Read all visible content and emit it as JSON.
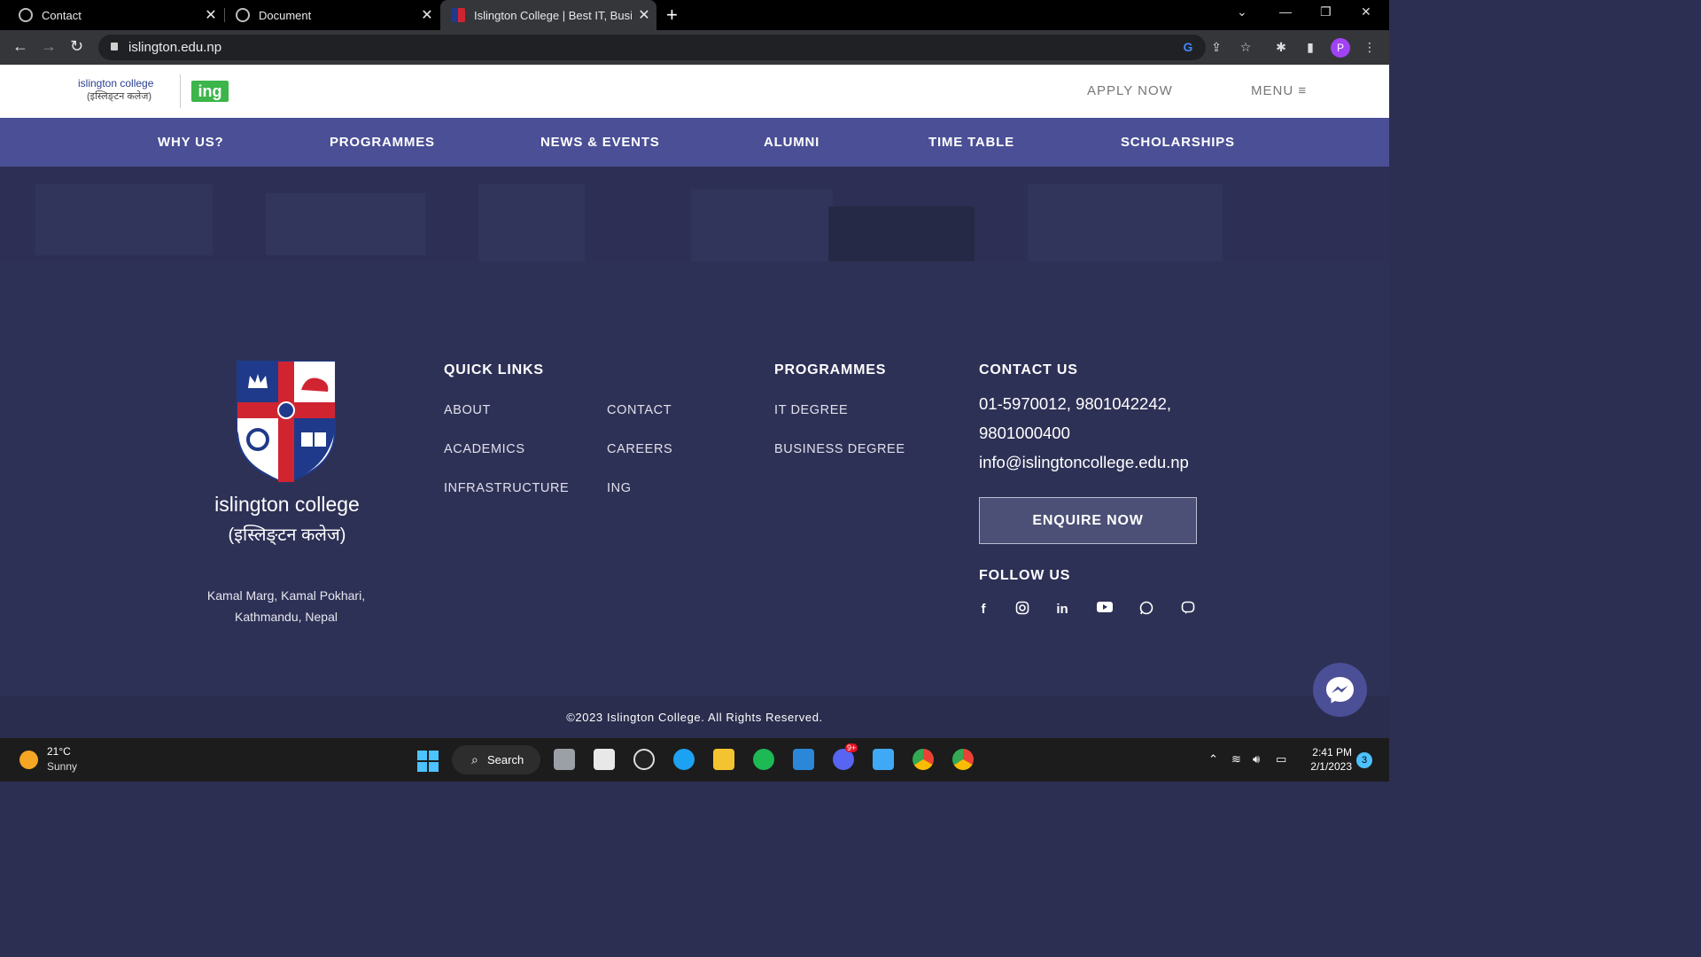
{
  "browser": {
    "tabs": [
      {
        "title": "Contact"
      },
      {
        "title": "Document"
      },
      {
        "title": "Islington College | Best IT, Busine"
      }
    ],
    "url": "islington.edu.np",
    "profile_initial": "P"
  },
  "header": {
    "logo_brand": "islington college",
    "logo_devanagari": "(इस्लिङ्टन कलेज)",
    "partner_logo": "ing",
    "apply_label": "APPLY NOW",
    "menu_label": "MENU ≡"
  },
  "nav": {
    "items": [
      "WHY US?",
      "PROGRAMMES",
      "NEWS & EVENTS",
      "ALUMNI",
      "TIME TABLE",
      "SCHOLARSHIPS"
    ]
  },
  "footer": {
    "college_name": "islington college",
    "college_devanagari": "(इस्लिङ्टन कलेज)",
    "address_line1": "Kamal Marg, Kamal Pokhari,",
    "address_line2": "Kathmandu, Nepal",
    "quick_links": {
      "heading": "QUICK LINKS",
      "col1": [
        "ABOUT",
        "ACADEMICS",
        "INFRASTRUCTURE"
      ],
      "col2": [
        "CONTACT",
        "CAREERS",
        "ING"
      ]
    },
    "programmes": {
      "heading": "PROGRAMMES",
      "items": [
        "IT DEGREE",
        "BUSINESS DEGREE"
      ]
    },
    "contact": {
      "heading": "CONTACT US",
      "phone_line1": "01-5970012, 9801042242,",
      "phone_line2": "9801000400",
      "email": "info@islingtoncollege.edu.np",
      "enquire_label": "ENQUIRE NOW"
    },
    "follow": {
      "heading": "FOLLOW US",
      "icons": [
        "facebook-icon",
        "instagram-icon",
        "linkedin-icon",
        "youtube-icon",
        "whatsapp-icon",
        "viber-icon"
      ]
    },
    "copyright": "©2023 Islington College. All Rights Reserved."
  },
  "taskbar": {
    "temperature": "21°C",
    "weather": "Sunny",
    "search_label": "Search",
    "time": "2:41 PM",
    "date": "2/1/2023",
    "notification_count": "3",
    "discord_badge": "9+"
  },
  "colors": {
    "nav_bg": "#4a4f96",
    "footer_bg": "#2e3156",
    "ing_green": "#3cb54a",
    "crest_red": "#d12431",
    "crest_blue": "#1f3a8a"
  }
}
